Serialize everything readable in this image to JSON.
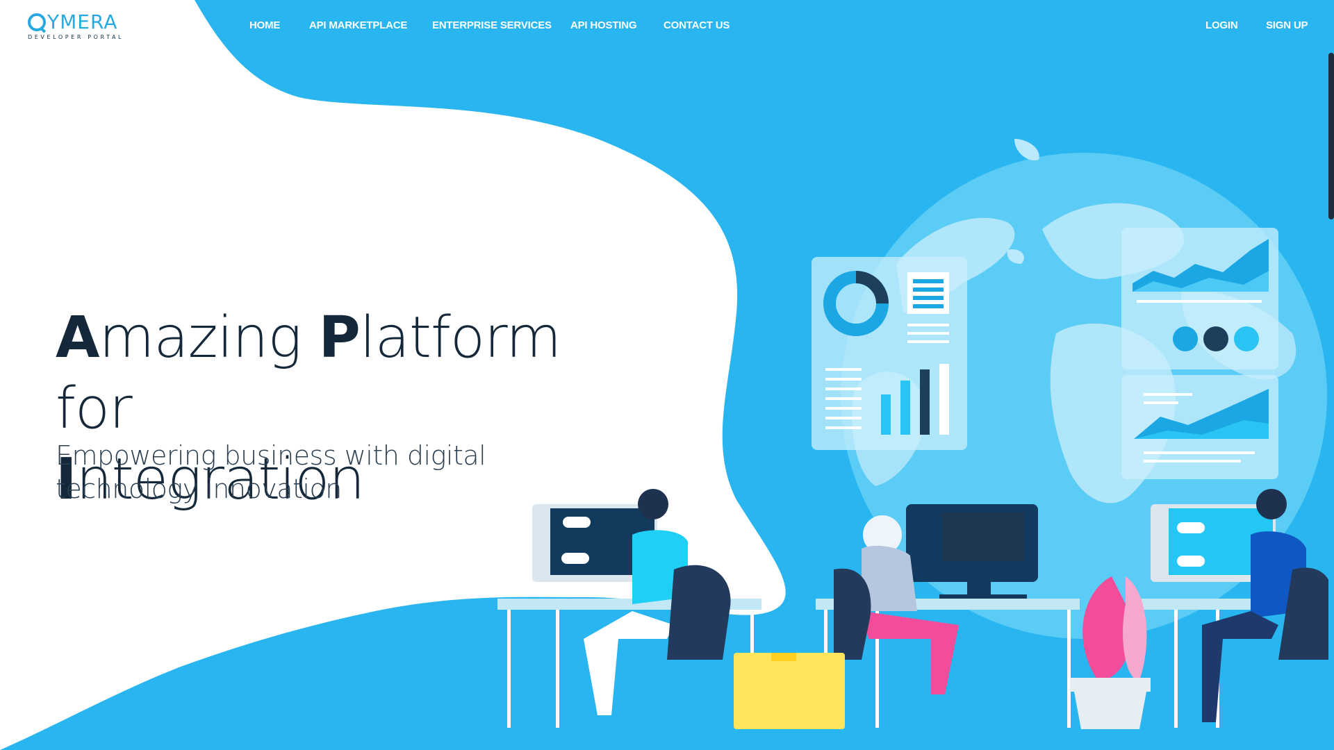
{
  "logo": {
    "word": "YMERA",
    "subtitle": "DEVELOPER PORTAL"
  },
  "nav": {
    "items": [
      {
        "label": "HOME"
      },
      {
        "label": "API MARKETPLACE"
      },
      {
        "label": "ENTERPRISE SERVICES"
      },
      {
        "label": "API HOSTING"
      },
      {
        "label": "CONTACT US"
      }
    ],
    "login": "LOGIN",
    "signup": "SIGN UP"
  },
  "hero": {
    "title_line1_cap1": "A",
    "title_line1_rest1": "mazing ",
    "title_line1_cap2": "P",
    "title_line1_rest2": "latform for",
    "title_line2_cap": "I",
    "title_line2_rest": "ntegration",
    "subtitle": "Empowering business with digital technology innovation"
  },
  "colors": {
    "brand_blue": "#29a9e1",
    "hero_bg": "#29b6f0",
    "dark_text": "#15283a"
  }
}
